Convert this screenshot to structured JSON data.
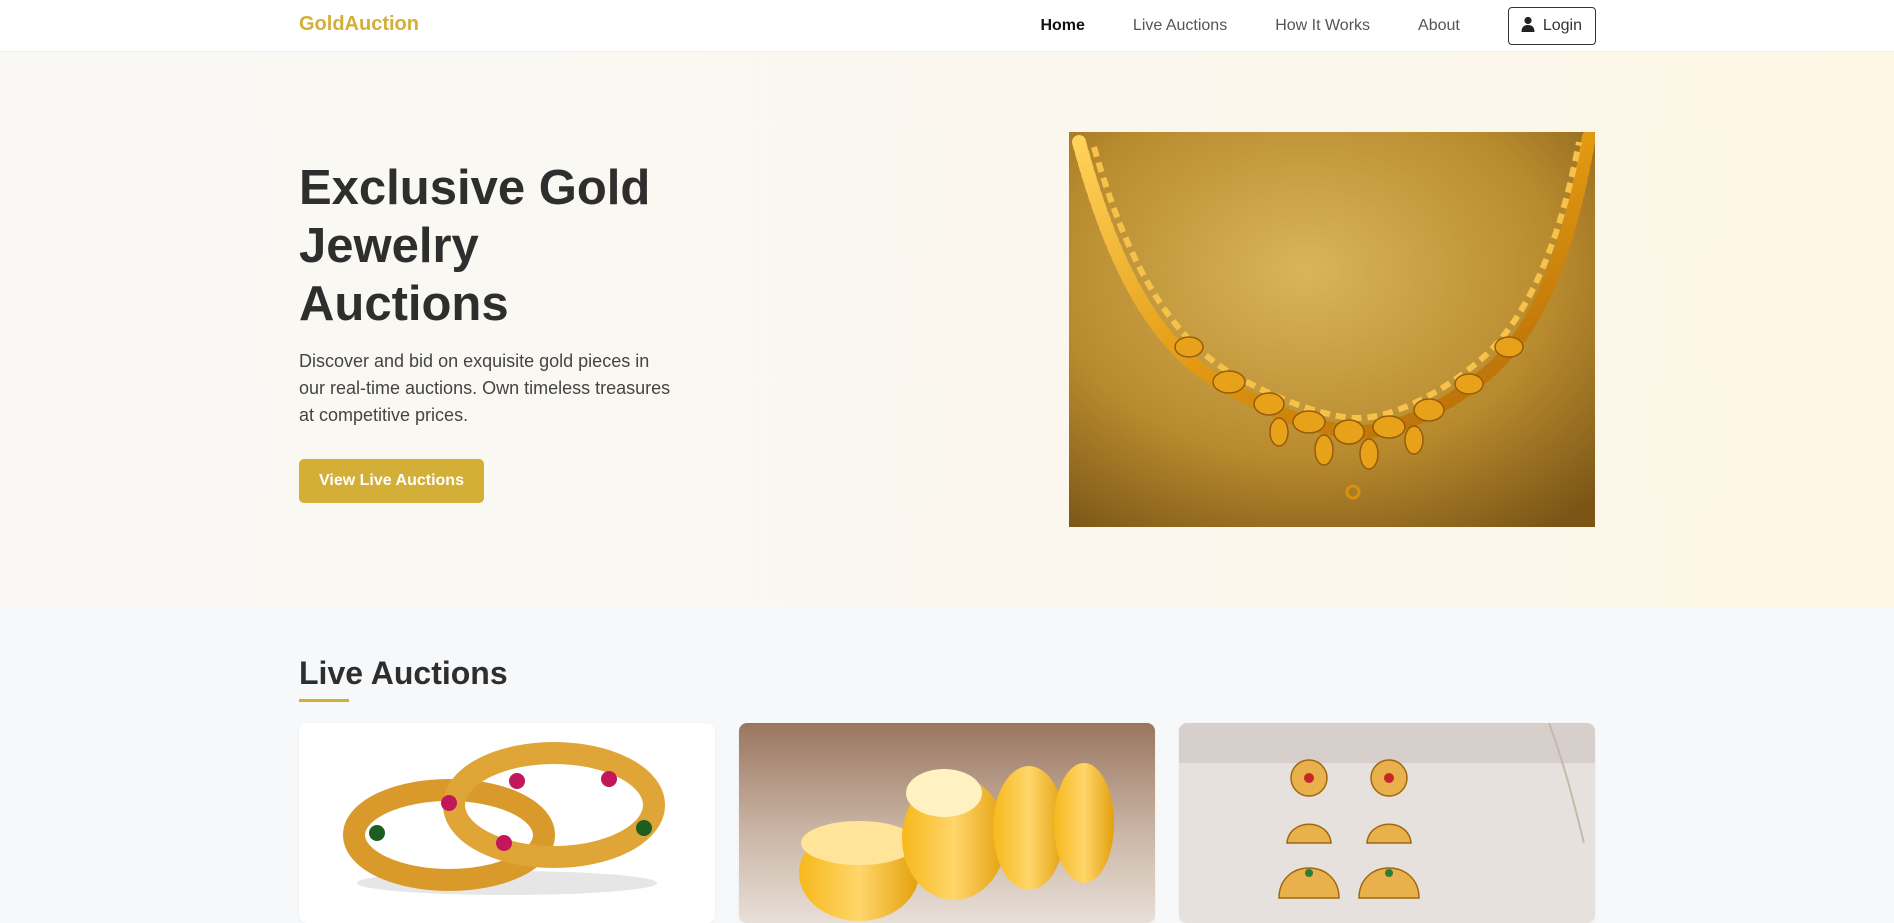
{
  "nav": {
    "brand": "GoldAuction",
    "links": [
      "Home",
      "Live Auctions",
      "How It Works",
      "About"
    ],
    "login": "Login"
  },
  "hero": {
    "title": "Exclusive Gold Jewelry Auctions",
    "subtitle": "Discover and bid on exquisite gold pieces in our real-time auctions. Own timeless treasures at competitive prices.",
    "cta": "View Live Auctions",
    "image": "gold-necklace-photo"
  },
  "live": {
    "title": "Live Auctions",
    "cards": [
      {
        "image": "gold-bangles-with-gems-photo"
      },
      {
        "image": "gold-rings-photo"
      },
      {
        "image": "gold-jhumka-earrings-photo"
      }
    ]
  },
  "colors": {
    "accent": "#d4af37",
    "dark": "#2e2e2e"
  }
}
